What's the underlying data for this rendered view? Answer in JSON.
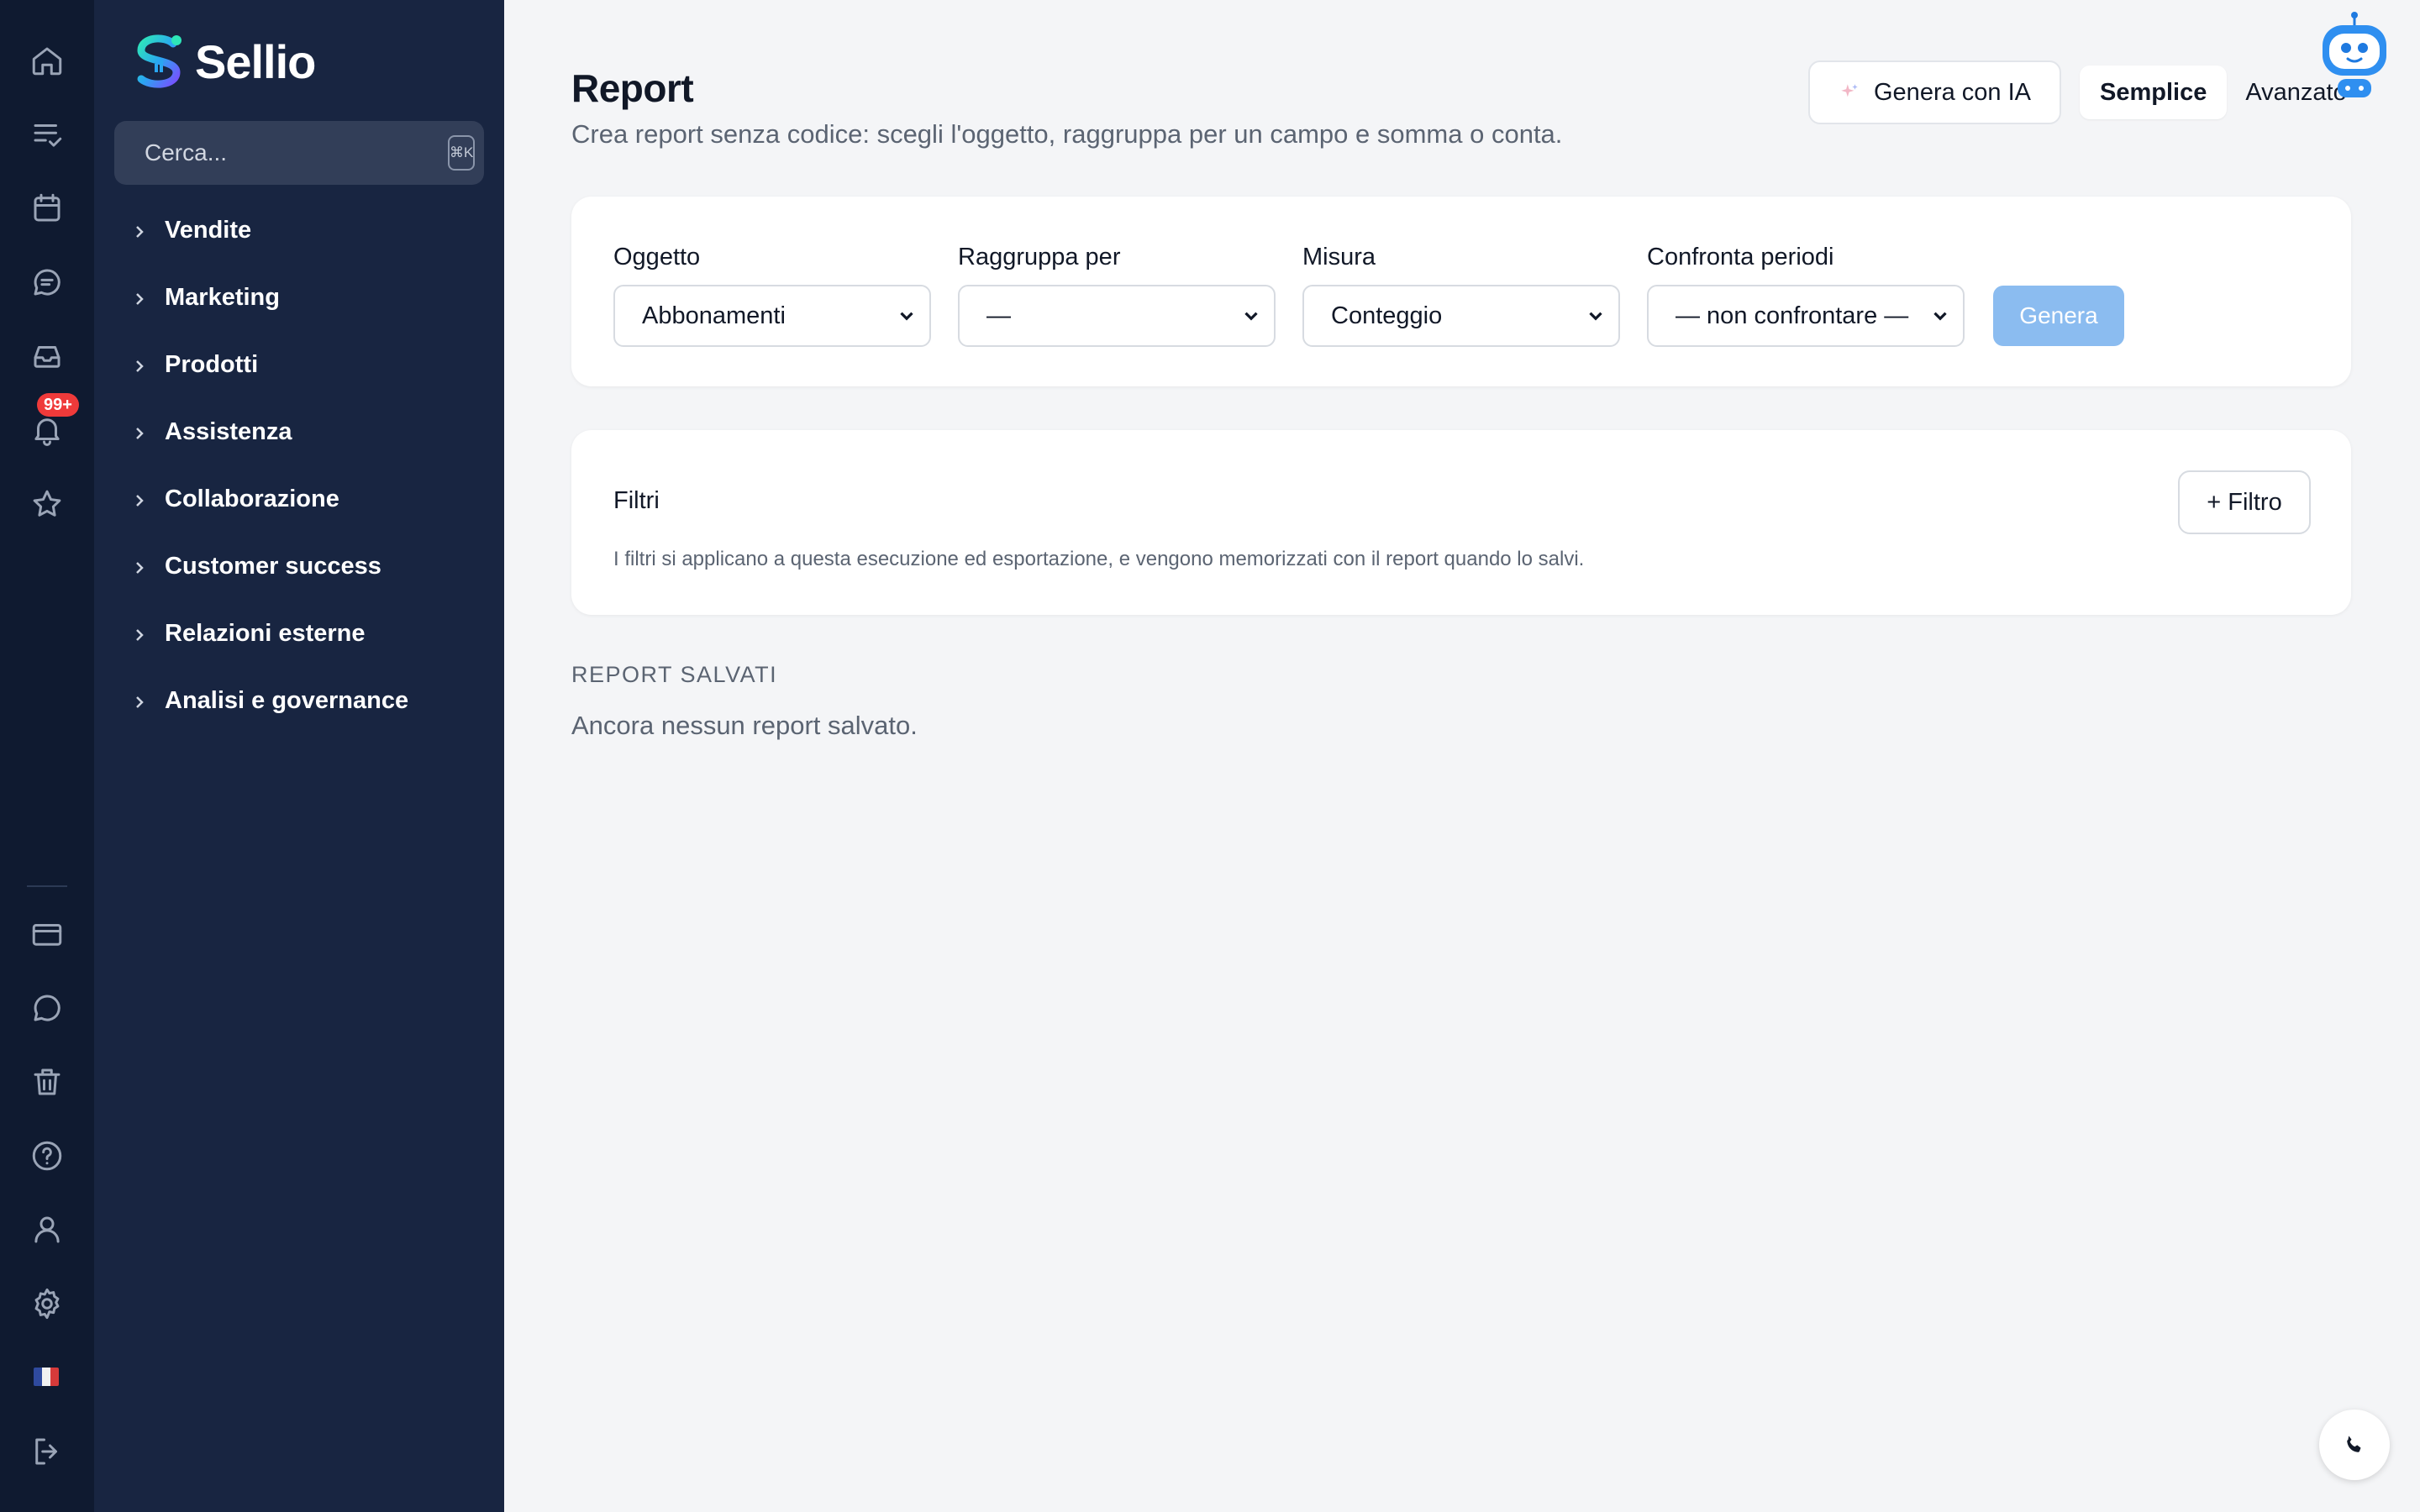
{
  "app": {
    "name": "Sellio"
  },
  "rail": {
    "notification_badge": "99+",
    "items_top": [
      "home-icon",
      "tasks-icon",
      "calendar-icon",
      "chat-icon",
      "inbox-icon",
      "bell-icon",
      "star-icon"
    ],
    "items_bottom": [
      "card-icon",
      "message-icon",
      "trash-icon",
      "help-icon",
      "user-icon",
      "gear-icon",
      "flag-icon",
      "logout-icon"
    ]
  },
  "sidebar": {
    "search_placeholder": "Cerca...",
    "search_shortcut": "⌘K",
    "items": [
      {
        "label": "Vendite"
      },
      {
        "label": "Marketing"
      },
      {
        "label": "Prodotti"
      },
      {
        "label": "Assistenza"
      },
      {
        "label": "Collaborazione"
      },
      {
        "label": "Customer success"
      },
      {
        "label": "Relazioni esterne"
      },
      {
        "label": "Analisi e governance"
      }
    ]
  },
  "header": {
    "title": "Report",
    "subtitle": "Crea report senza codice: scegli l'oggetto, raggruppa per un campo e somma o conta.",
    "ai_button": "Genera con IA",
    "mode_simple": "Semplice",
    "mode_advanced": "Avanzato"
  },
  "builder": {
    "object_label": "Oggetto",
    "object_value": "Abbonamenti",
    "group_label": "Raggruppa per",
    "group_value": "—",
    "measure_label": "Misura",
    "measure_value": "Conteggio",
    "compare_label": "Confronta periodi",
    "compare_value": "— non confrontare —",
    "generate_button": "Genera"
  },
  "filters": {
    "title": "Filtri",
    "add_button": "+ Filtro",
    "note": "I filtri si applicano a questa esecuzione ed esportazione, e vengono memorizzati con il report quando lo salvi."
  },
  "saved": {
    "title": "REPORT SALVATI",
    "empty": "Ancora nessun report salvato."
  },
  "colors": {
    "accent": "#8bbcf0",
    "sidebar": "#182541",
    "rail": "#0f1a30",
    "badge": "#ef3a3a"
  }
}
